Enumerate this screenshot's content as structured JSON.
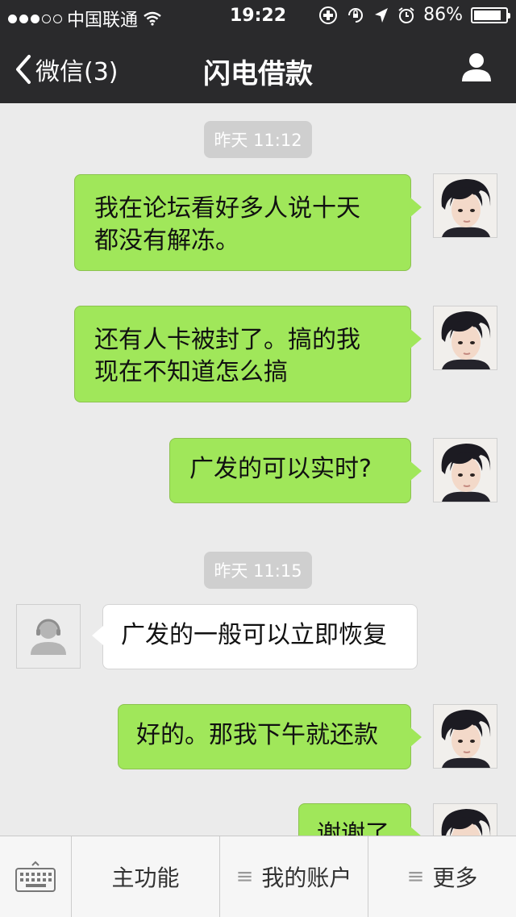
{
  "status_bar": {
    "carrier": "中国联通",
    "time": "19:22",
    "battery": "86%",
    "battery_level": 0.86
  },
  "nav": {
    "back_label": "微信(3)",
    "title": "闪电借款"
  },
  "timestamps": [
    "昨天 11:12",
    "昨天 11:15"
  ],
  "messages": [
    {
      "from": "me",
      "lines": [
        "我在论坛看好多人说十天",
        "都没有解冻。"
      ]
    },
    {
      "from": "me",
      "lines": [
        "还有人卡被封了。搞的我",
        "现在不知道怎么搞"
      ]
    },
    {
      "from": "me",
      "lines": [
        "广发的可以实时?"
      ]
    },
    {
      "from": "service",
      "lines": [
        "广发的一般可以立即恢复"
      ]
    },
    {
      "from": "me",
      "lines": [
        "好的。那我下午就还款"
      ]
    },
    {
      "from": "me",
      "lines": [
        "谢谢了"
      ]
    }
  ],
  "bottom_bar": {
    "keyboard": "keyboard-icon",
    "main_function": "主功能",
    "my_account": "我的账户",
    "more": "更多"
  },
  "colors": {
    "bar_bg": "#2a2a2c",
    "chat_bg": "#ebebeb",
    "my_bubble": "#a0e75a",
    "their_bubble": "#ffffff"
  }
}
